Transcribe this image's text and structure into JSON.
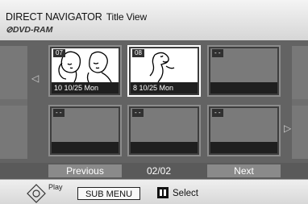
{
  "header": {
    "title": "DIRECT NAVIGATOR",
    "view": "Title View",
    "disc": "DVD-RAM"
  },
  "tiles": [
    {
      "number": "07",
      "info": "10  10/25 Mon",
      "has_thumbnail": true,
      "selected": false
    },
    {
      "number": "08",
      "info": "8   10/25 Mon",
      "has_thumbnail": true,
      "selected": true
    },
    {
      "number": "- -",
      "info": "",
      "has_thumbnail": false,
      "selected": false
    },
    {
      "number": "- -",
      "info": "",
      "has_thumbnail": false,
      "selected": false
    },
    {
      "number": "- -",
      "info": "",
      "has_thumbnail": false,
      "selected": false
    },
    {
      "number": "- -",
      "info": "",
      "has_thumbnail": false,
      "selected": false
    }
  ],
  "nav": {
    "previous": "Previous",
    "page": "02/02",
    "next": "Next"
  },
  "footer": {
    "play": "Play",
    "submenu": "SUB MENU",
    "select": "Select"
  },
  "icons": {
    "disc": "disc-icon",
    "dial": "navigation-dial-icon",
    "pause": "pause-icon",
    "left": "arrow-left-icon",
    "right": "arrow-right-icon"
  }
}
